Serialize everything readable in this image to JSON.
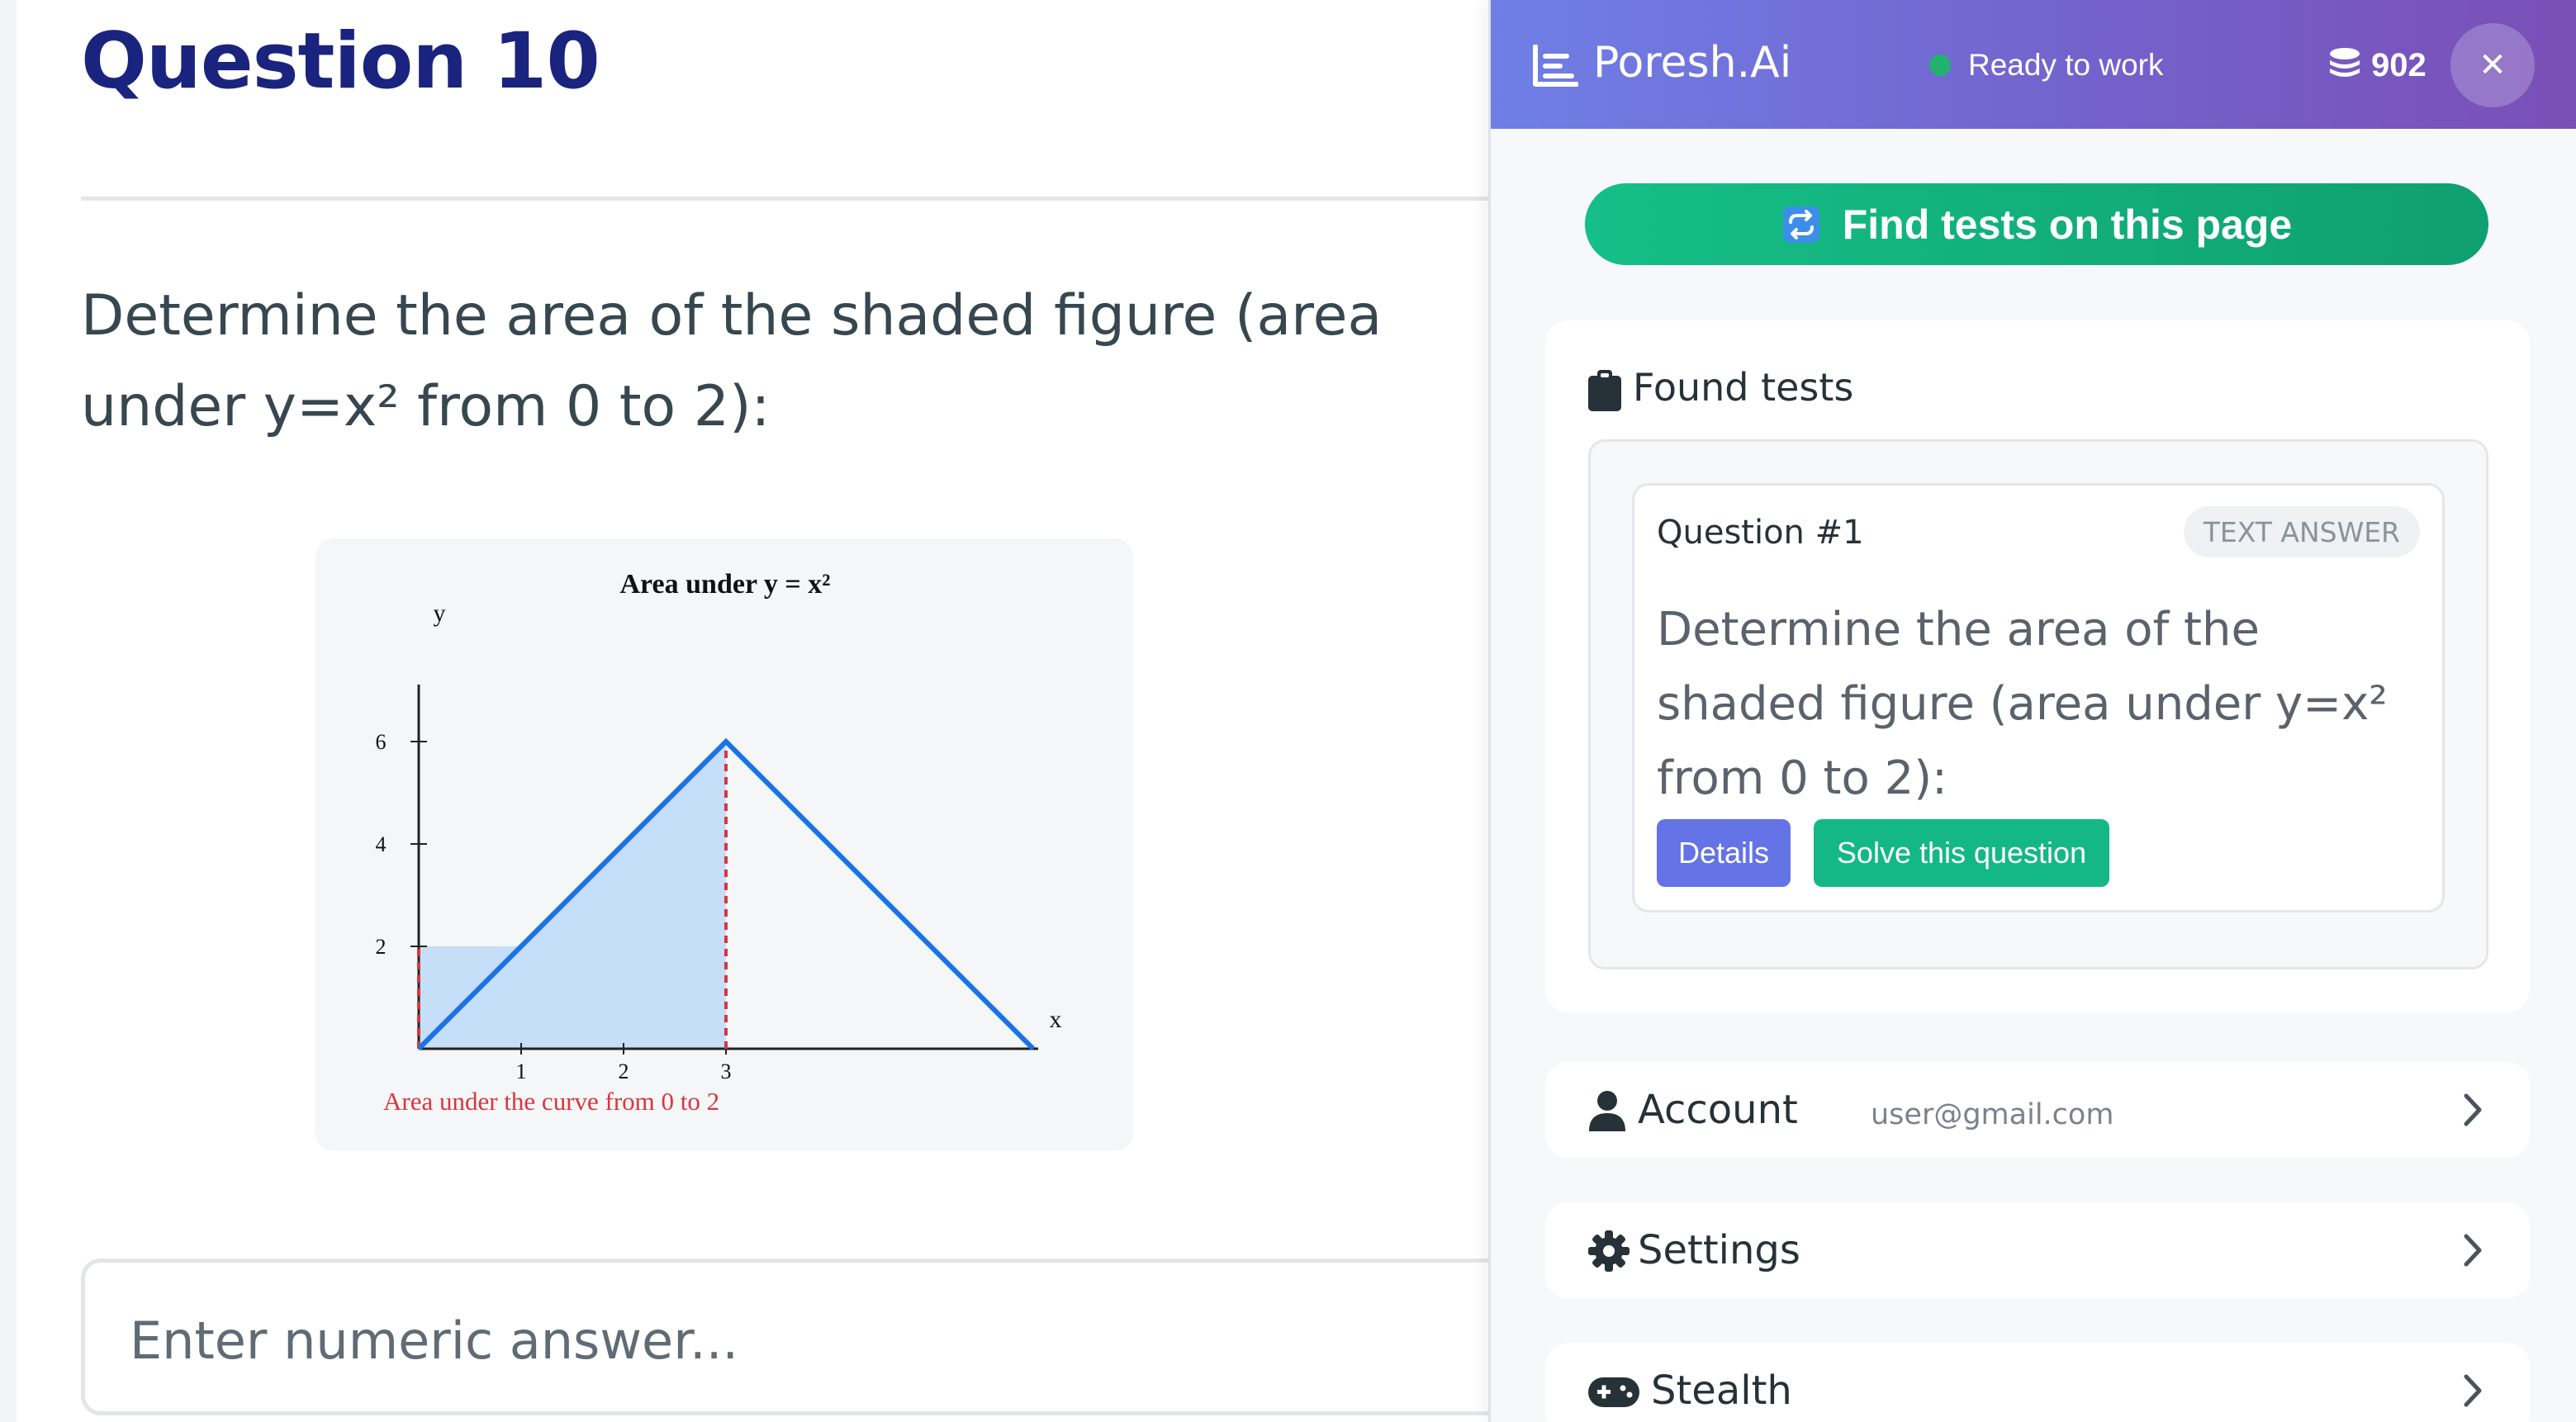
{
  "question": {
    "heading": "Question 10",
    "text": "Determine the area of the shaded figure (area under y=x² from 0 to 2):",
    "answer_placeholder": "Enter numeric answer..."
  },
  "figure": {
    "chart_data": {
      "type": "line",
      "title": "Area under y = x²",
      "xlabel": "x",
      "ylabel": "y",
      "x_ticks": [
        1,
        2,
        3
      ],
      "y_ticks": [
        2,
        4,
        6
      ],
      "xlim": [
        0,
        6
      ],
      "ylim": [
        0,
        7.5
      ],
      "series": [
        {
          "x": [
            0,
            3,
            6
          ],
          "y": [
            0,
            6,
            0
          ],
          "color": "#1a73e8"
        }
      ],
      "shaded_region": {
        "x": [
          0,
          3
        ],
        "color": "#c6def7"
      },
      "marker_lines": [
        {
          "x": 0,
          "style": "dashed",
          "color": "#d9363e"
        },
        {
          "x": 3,
          "style": "dashed",
          "color": "#d9363e"
        }
      ],
      "annotation": {
        "text": "Area under the curve from 0 to 2",
        "color": "#d9363e"
      }
    }
  },
  "extension": {
    "brand": "Poresh.Ai",
    "status": "Ready to work",
    "coins": "902",
    "close_symbol": "✕",
    "find_button": "Find tests on this page",
    "found_title": "Found tests",
    "tests": [
      {
        "title": "Question #1",
        "type": "TEXT ANSWER",
        "text": "Determine the area of the shaded figure (area under y=x² from 0 to 2):",
        "details_label": "Details",
        "solve_label": "Solve this question"
      }
    ],
    "menu": {
      "account": {
        "label": "Account",
        "sub": "user@gmail.com",
        "icon": "user-icon"
      },
      "settings": {
        "label": "Settings",
        "icon": "gear-icon"
      },
      "stealth": {
        "label": "Stealth",
        "icon": "gamepad-icon"
      }
    },
    "colors": {
      "header_gradient": [
        "#6f7fe6",
        "#7a4fb6"
      ],
      "find_green": "#15bf86",
      "details_blue": "#6473e6",
      "solve_green": "#14b886",
      "status_dot": "#22b26e"
    }
  }
}
